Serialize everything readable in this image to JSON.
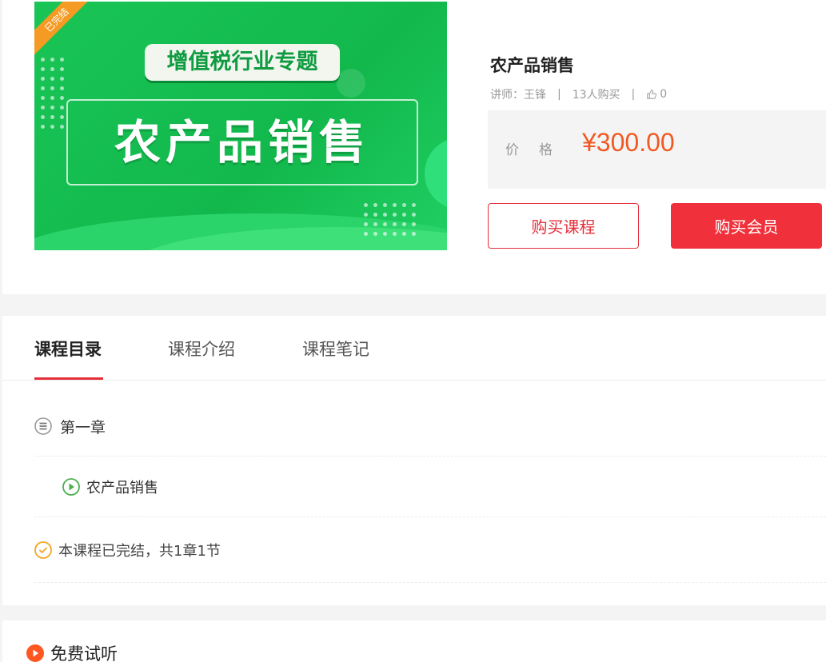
{
  "course": {
    "cover_ribbon": "已完结",
    "cover_tag": "增值税行业专题",
    "cover_title": "农产品销售",
    "title": "农产品销售",
    "teacher": "讲师：王锋",
    "buyers": "13人购买",
    "likes": "0",
    "price_label": "价格",
    "price": "¥300.00",
    "buy_label": "购买课程",
    "vip_label": "购买会员"
  },
  "tabs": [
    {
      "label": "课程目录",
      "active": true
    },
    {
      "label": "课程介绍",
      "active": false
    },
    {
      "label": "课程笔记",
      "active": false
    }
  ],
  "catalog": {
    "chapter": "第一章",
    "lesson": "农产品销售",
    "status": "本课程已完结，共1章1节"
  },
  "free_trial": {
    "label": "免费试听"
  },
  "colors": {
    "accent_red": "#e52f3a",
    "price_orange": "#f05a22",
    "lesson_green": "#4caf50",
    "done_orange": "#f5a623"
  }
}
